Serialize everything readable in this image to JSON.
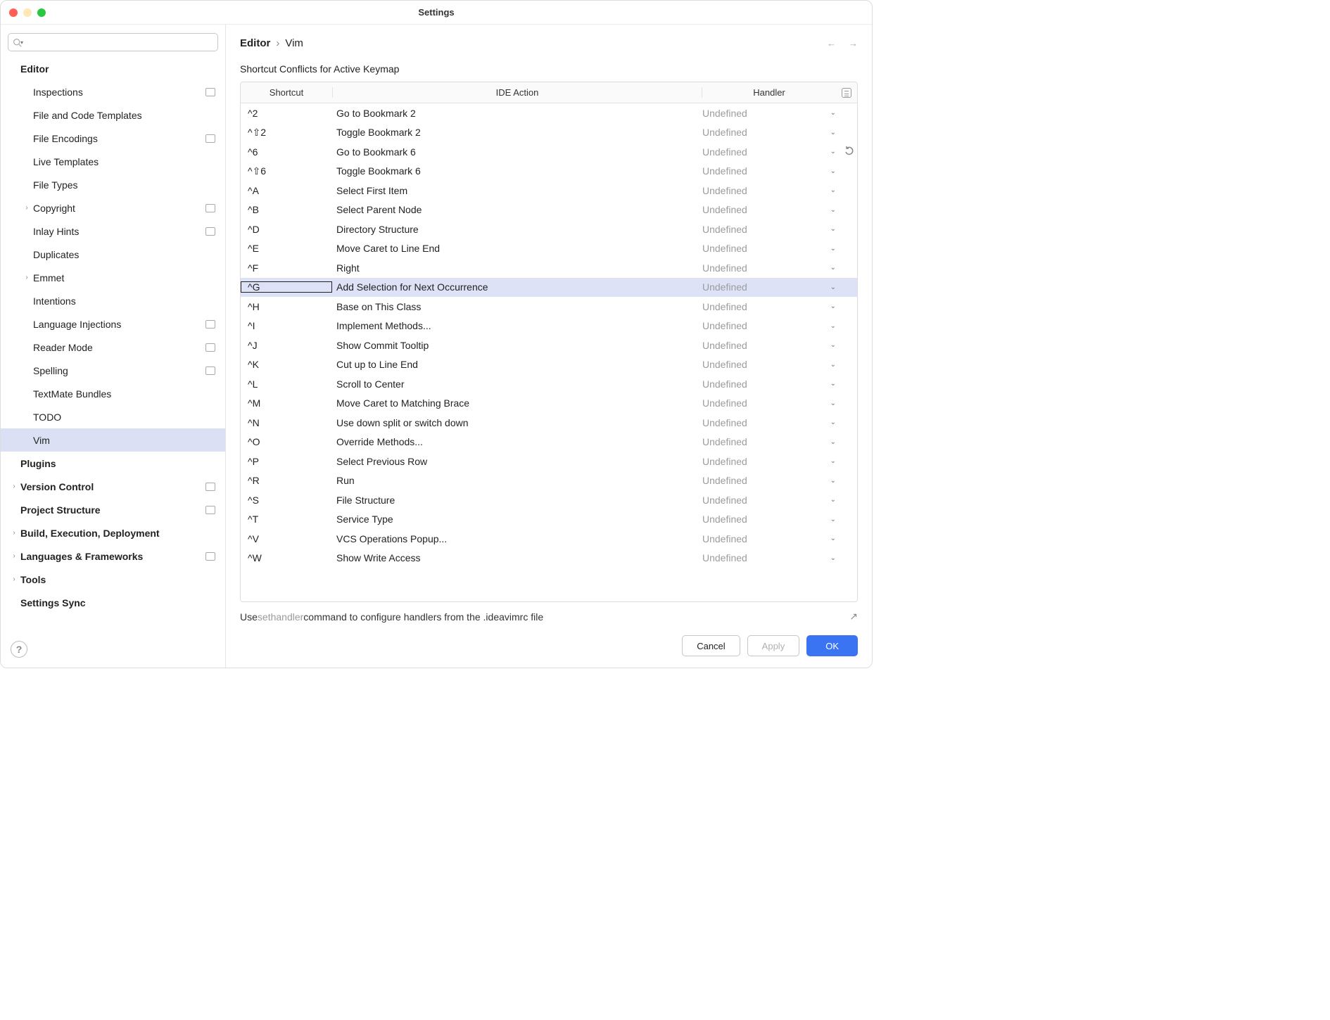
{
  "window": {
    "title": "Settings"
  },
  "search": {
    "placeholder": ""
  },
  "sidebar": {
    "items": [
      {
        "label": "Editor",
        "bold": true,
        "indent": 0,
        "arrow": false,
        "badge": false
      },
      {
        "label": "Inspections",
        "bold": false,
        "indent": 1,
        "arrow": false,
        "badge": true
      },
      {
        "label": "File and Code Templates",
        "bold": false,
        "indent": 1,
        "arrow": false,
        "badge": false
      },
      {
        "label": "File Encodings",
        "bold": false,
        "indent": 1,
        "arrow": false,
        "badge": true
      },
      {
        "label": "Live Templates",
        "bold": false,
        "indent": 1,
        "arrow": false,
        "badge": false
      },
      {
        "label": "File Types",
        "bold": false,
        "indent": 1,
        "arrow": false,
        "badge": false
      },
      {
        "label": "Copyright",
        "bold": false,
        "indent": 1,
        "arrow": true,
        "badge": true
      },
      {
        "label": "Inlay Hints",
        "bold": false,
        "indent": 1,
        "arrow": false,
        "badge": true
      },
      {
        "label": "Duplicates",
        "bold": false,
        "indent": 1,
        "arrow": false,
        "badge": false
      },
      {
        "label": "Emmet",
        "bold": false,
        "indent": 1,
        "arrow": true,
        "badge": false
      },
      {
        "label": "Intentions",
        "bold": false,
        "indent": 1,
        "arrow": false,
        "badge": false
      },
      {
        "label": "Language Injections",
        "bold": false,
        "indent": 1,
        "arrow": false,
        "badge": true
      },
      {
        "label": "Reader Mode",
        "bold": false,
        "indent": 1,
        "arrow": false,
        "badge": true
      },
      {
        "label": "Spelling",
        "bold": false,
        "indent": 1,
        "arrow": false,
        "badge": true
      },
      {
        "label": "TextMate Bundles",
        "bold": false,
        "indent": 1,
        "arrow": false,
        "badge": false
      },
      {
        "label": "TODO",
        "bold": false,
        "indent": 1,
        "arrow": false,
        "badge": false
      },
      {
        "label": "Vim",
        "bold": false,
        "indent": 1,
        "arrow": false,
        "badge": false,
        "selected": true
      },
      {
        "label": "Plugins",
        "bold": true,
        "indent": 0,
        "arrow": false,
        "badge": false
      },
      {
        "label": "Version Control",
        "bold": true,
        "indent": 0,
        "arrow": true,
        "badge": true
      },
      {
        "label": "Project Structure",
        "bold": true,
        "indent": 0,
        "arrow": false,
        "badge": true
      },
      {
        "label": "Build, Execution, Deployment",
        "bold": true,
        "indent": 0,
        "arrow": true,
        "badge": false
      },
      {
        "label": "Languages & Frameworks",
        "bold": true,
        "indent": 0,
        "arrow": true,
        "badge": true
      },
      {
        "label": "Tools",
        "bold": true,
        "indent": 0,
        "arrow": true,
        "badge": false
      },
      {
        "label": "Settings Sync",
        "bold": true,
        "indent": 0,
        "arrow": false,
        "badge": false
      }
    ]
  },
  "breadcrumb": {
    "root": "Editor",
    "sep": "›",
    "leaf": "Vim"
  },
  "section_title": "Shortcut Conflicts for Active Keymap",
  "table": {
    "columns": {
      "shortcut": "Shortcut",
      "action": "IDE Action",
      "handler": "Handler"
    },
    "rows": [
      {
        "shortcut": "^2",
        "action": "Go to Bookmark 2",
        "handler": "Undefined"
      },
      {
        "shortcut": "^⇧2",
        "action": "Toggle Bookmark 2",
        "handler": "Undefined"
      },
      {
        "shortcut": "^6",
        "action": "Go to Bookmark 6",
        "handler": "Undefined"
      },
      {
        "shortcut": "^⇧6",
        "action": "Toggle Bookmark 6",
        "handler": "Undefined"
      },
      {
        "shortcut": "^A",
        "action": "Select First Item",
        "handler": "Undefined"
      },
      {
        "shortcut": "^B",
        "action": "Select Parent Node",
        "handler": "Undefined"
      },
      {
        "shortcut": "^D",
        "action": "Directory Structure",
        "handler": "Undefined"
      },
      {
        "shortcut": "^E",
        "action": "Move Caret to Line End",
        "handler": "Undefined"
      },
      {
        "shortcut": "^F",
        "action": "Right",
        "handler": "Undefined"
      },
      {
        "shortcut": "^G",
        "action": "Add Selection for Next Occurrence",
        "handler": "Undefined",
        "selected": true
      },
      {
        "shortcut": "^H",
        "action": "Base on This Class",
        "handler": "Undefined"
      },
      {
        "shortcut": "^I",
        "action": "Implement Methods...",
        "handler": "Undefined"
      },
      {
        "shortcut": "^J",
        "action": "Show Commit Tooltip",
        "handler": "Undefined"
      },
      {
        "shortcut": "^K",
        "action": "Cut up to Line End",
        "handler": "Undefined"
      },
      {
        "shortcut": "^L",
        "action": "Scroll to Center",
        "handler": "Undefined"
      },
      {
        "shortcut": "^M",
        "action": "Move Caret to Matching Brace",
        "handler": "Undefined"
      },
      {
        "shortcut": "^N",
        "action": "Use down split or switch down",
        "handler": "Undefined"
      },
      {
        "shortcut": "^O",
        "action": "Override Methods...",
        "handler": "Undefined"
      },
      {
        "shortcut": "^P",
        "action": "Select Previous Row",
        "handler": "Undefined"
      },
      {
        "shortcut": "^R",
        "action": "Run",
        "handler": "Undefined"
      },
      {
        "shortcut": "^S",
        "action": "File Structure",
        "handler": "Undefined"
      },
      {
        "shortcut": "^T",
        "action": "Service Type",
        "handler": "Undefined"
      },
      {
        "shortcut": "^V",
        "action": "VCS Operations Popup...",
        "handler": "Undefined"
      },
      {
        "shortcut": "^W",
        "action": "Show Write Access",
        "handler": "Undefined"
      }
    ]
  },
  "hint": {
    "prefix": "Use ",
    "command": "sethandler",
    "suffix": " command to configure handlers from the .ideavimrc file"
  },
  "buttons": {
    "cancel": "Cancel",
    "apply": "Apply",
    "ok": "OK"
  }
}
